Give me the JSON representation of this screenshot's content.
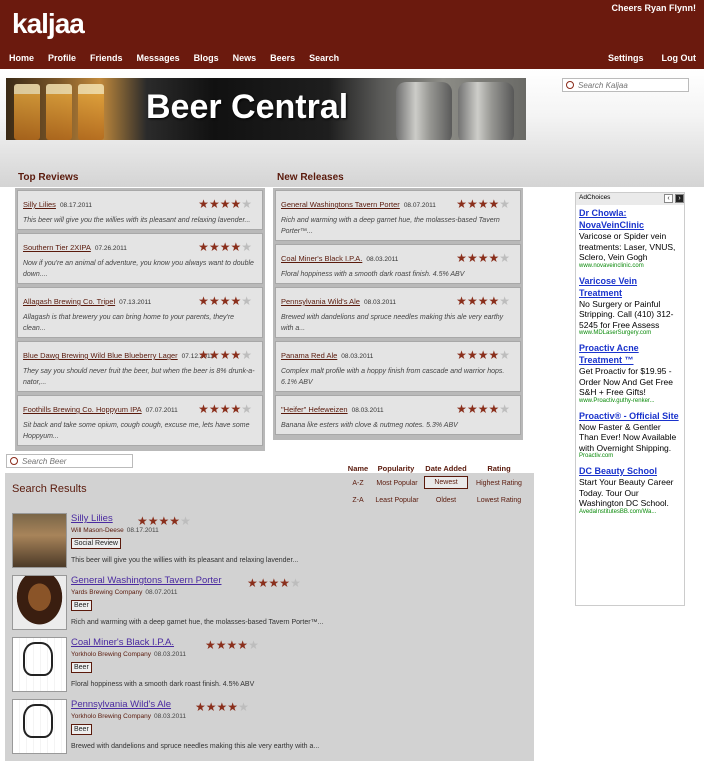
{
  "topbar": {
    "logo": "kaljaa",
    "greeting": "Cheers Ryan Flynn!",
    "nav": [
      "Home",
      "Profile",
      "Friends",
      "Messages",
      "Blogs",
      "News",
      "Beers",
      "Search"
    ],
    "right_nav": [
      "Settings",
      "Log Out"
    ]
  },
  "site_search": {
    "placeholder": "Search Kaljaa"
  },
  "banner": {
    "title": "Beer Central"
  },
  "top_reviews": {
    "heading": "Top Reviews",
    "items": [
      {
        "name": "Silly Lilies",
        "date": "08.17.2011",
        "rating": 4,
        "desc": "This beer will give you the willies with its pleasant and relaxing lavender..."
      },
      {
        "name": "Southern Tier 2XIPA",
        "date": "07.26.2011",
        "rating": 4,
        "desc": "Now if you're an animal of adventure, you know you always want to double down...."
      },
      {
        "name": "Allagash Brewing Co. Tripel",
        "date": "07.13.2011",
        "rating": 4,
        "desc": "Allagash is that brewery you can bring home to your parents, they're clean..."
      },
      {
        "name": "Blue Dawg Brewing Wild Blue Blueberry Lager",
        "date": "07.12.2011",
        "rating": 4,
        "desc": "They say you should never fruit the beer, but when the beer is 8% drunk-a-nator,..."
      },
      {
        "name": "Foothills Brewing Co. Hoppyum IPA",
        "date": "07.07.2011",
        "rating": 4,
        "desc": "Sit back and take some opium, cough cough, excuse me, lets have some Hoppyum..."
      }
    ]
  },
  "new_releases": {
    "heading": "New Releases",
    "items": [
      {
        "name": "General Washingtons Tavern Porter",
        "date": "08.07.2011",
        "rating": 4,
        "desc": "Rich and warming with a deep garnet hue, the molasses-based Tavern Porter™..."
      },
      {
        "name": "Coal Miner's Black I.P.A.",
        "date": "08.03.2011",
        "rating": 4,
        "desc": "Floral hoppiness with a smooth dark roast finish. 4.5% ABV"
      },
      {
        "name": "Pennsylvania Wild's Ale",
        "date": "08.03.2011",
        "rating": 4,
        "desc": "Brewed with dandelions and spruce needles making this ale very earthy with a..."
      },
      {
        "name": "Panama Red Ale",
        "date": "08.03.2011",
        "rating": 4,
        "desc": "Complex malt profile with a hoppy finish from cascade and warrior hops. 6.1% ABV"
      },
      {
        "name": "\"Heifer\" Hefeweizen",
        "date": "08.03.2011",
        "rating": 4,
        "desc": "Banana like esters with clove & nutmeg notes. 5.3% ABV"
      }
    ]
  },
  "beer_search": {
    "placeholder": "Search Beer"
  },
  "results": {
    "title": "Search Results",
    "headers": [
      "Name",
      "Popularity",
      "Date Added",
      "Rating"
    ],
    "sort": {
      "name": [
        "A-Z",
        "Z-A"
      ],
      "popularity": [
        "Most Popular",
        "Least Popular"
      ],
      "date": [
        "Newest",
        "Oldest"
      ],
      "rating": [
        "Highest Rating",
        "Lowest Rating"
      ]
    },
    "selected_sort": "Newest",
    "items": [
      {
        "name": "Silly Lilies",
        "by": "Will Mason-Deese",
        "date": "08.17.2011",
        "tag": "Social Review",
        "rating": 4,
        "text": "This beer will give you the willies with its pleasant and relaxing lavender..."
      },
      {
        "name": "General Washingtons Tavern Porter",
        "by": "Yards Brewing Company",
        "date": "08.07.2011",
        "tag": "Beer",
        "rating": 4,
        "text": "Rich and warming with a deep garnet hue, the molasses-based Tavern Porter™..."
      },
      {
        "name": "Coal Miner's Black I.P.A.",
        "by": "Yorkholo Brewing Company",
        "date": "08.03.2011",
        "tag": "Beer",
        "rating": 4,
        "text": "Floral hoppiness with a smooth dark roast finish. 4.5% ABV"
      },
      {
        "name": "Pennsylvania Wild's Ale",
        "by": "Yorkholo Brewing Company",
        "date": "08.03.2011",
        "tag": "Beer",
        "rating": 4,
        "text": "Brewed with dandelions and spruce needles making this ale very earthy with a..."
      }
    ]
  },
  "ads": {
    "label": "AdChoices",
    "items": [
      {
        "title": "Dr Chowla: NovaVeinClinic",
        "body": "Varicose or Spider vein treatments: Laser, VNUS, Sclero, Vein Gogh",
        "url": "www.novaveinclinic.com"
      },
      {
        "title": "Varicose Vein Treatment",
        "body": "No Surgery or Painful Stripping. Call (410) 312-5245 for Free Assess",
        "url": "www.MDLaserSurgery.com"
      },
      {
        "title": "Proactiv Acne Treatment ™",
        "body": "Get Proactiv for $19.95 - Order Now And Get Free S&H + Free Gifts!",
        "url": "www.Proactiv.guthy-renker..."
      },
      {
        "title": "Proactiv® - Official Site",
        "body": "Now Faster & Gentler Than Ever! Now Available with Overnight Shipping.",
        "url": "Proactiv.com"
      },
      {
        "title": "DC Beauty School",
        "body": "Start Your Beauty Career Today. Tour Our Washington DC School.",
        "url": "AvedaInstitutesBB.com/Wa..."
      }
    ]
  },
  "colors": {
    "brand": "#6b1a0e",
    "accent": "#8a2f1c",
    "link": "#4a2aa0"
  }
}
